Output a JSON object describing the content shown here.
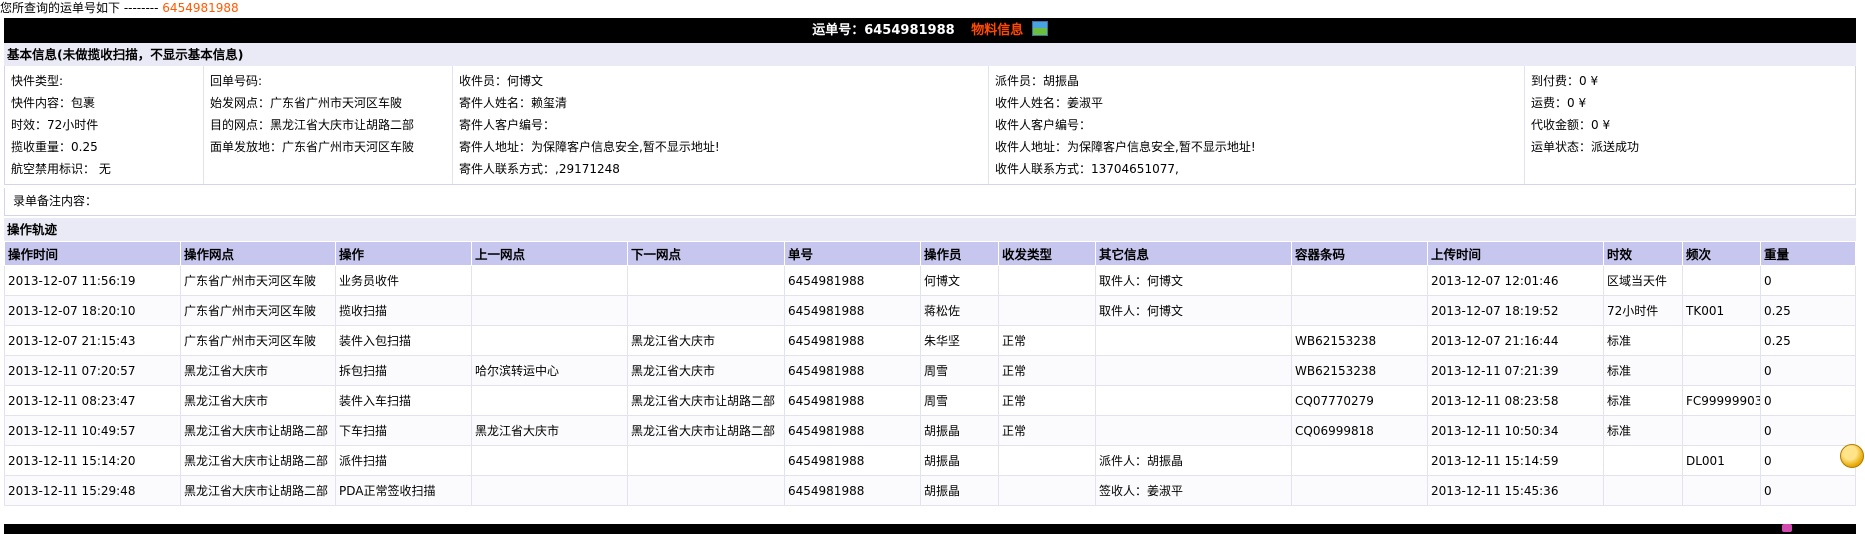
{
  "query": {
    "prefix": "您所查询的运单号如下 --------",
    "number": "6454981988"
  },
  "title": {
    "label": "运单号：6454981988",
    "material_link": "物料信息"
  },
  "basic": {
    "heading": "基本信息(未做揽收扫描，不显示基本信息)",
    "col1": [
      "快件类型:",
      "快件内容：包裹",
      "时效：72小时件",
      "揽收重量：0.25",
      "航空禁用标识： 无"
    ],
    "col2": [
      "回单号码:",
      "始发网点：广东省广州市天河区车陂",
      "目的网点：黑龙江省大庆市让胡路二部",
      "面单发放地：广东省广州市天河区车陂"
    ],
    "col3": [
      "收件员：何博文",
      "寄件人姓名：赖玺清",
      "寄件人客户编号：",
      "寄件人地址：为保障客户信息安全,暂不显示地址!",
      "寄件人联系方式：,29171248"
    ],
    "col4": [
      "派件员：胡振晶",
      "收件人姓名：姜淑平",
      "收件人客户编号：",
      "收件人地址：为保障客户信息安全,暂不显示地址!",
      "收件人联系方式：13704651077,"
    ],
    "col5": [
      "到付费：0 ¥",
      "运费：0 ¥",
      "代收金额：0 ¥",
      "运单状态：派送成功"
    ]
  },
  "remarks": {
    "label": "录单备注内容："
  },
  "track": {
    "heading": "操作轨迹",
    "columns": [
      "操作时间",
      "操作网点",
      "操作",
      "上一网点",
      "下一网点",
      "单号",
      "操作员",
      "收发类型",
      "其它信息",
      "容器条码",
      "上传时间",
      "时效",
      "频次",
      "重量"
    ],
    "rows": [
      [
        "2013-12-07 11:56:19",
        "广东省广州市天河区车陂",
        "业务员收件",
        "",
        "",
        "6454981988",
        "何博文",
        "",
        "取件人：何博文",
        "",
        "2013-12-07 12:01:46",
        "区域当天件",
        "",
        "0"
      ],
      [
        "2013-12-07 18:20:10",
        "广东省广州市天河区车陂",
        "揽收扫描",
        "",
        "",
        "6454981988",
        "蒋松佐",
        "",
        "取件人：何博文",
        "",
        "2013-12-07 18:19:52",
        "72小时件",
        "TK001",
        "0.25"
      ],
      [
        "2013-12-07 21:15:43",
        "广东省广州市天河区车陂",
        "装件入包扫描",
        "",
        "黑龙江省大庆市",
        "6454981988",
        "朱华坚",
        "正常",
        "",
        "WB62153238",
        "2013-12-07 21:16:44",
        "标准",
        "",
        "0.25"
      ],
      [
        "2013-12-11 07:20:57",
        "黑龙江省大庆市",
        "拆包扫描",
        "哈尔滨转运中心",
        "黑龙江省大庆市",
        "6454981988",
        "周雪",
        "正常",
        "",
        "WB62153238",
        "2013-12-11 07:21:39",
        "标准",
        "",
        "0"
      ],
      [
        "2013-12-11 08:23:47",
        "黑龙江省大庆市",
        "装件入车扫描",
        "",
        "黑龙江省大庆市让胡路二部",
        "6454981988",
        "周雪",
        "正常",
        "",
        "CQ07770279",
        "2013-12-11 08:23:58",
        "标准",
        "FC99999903",
        "0"
      ],
      [
        "2013-12-11 10:49:57",
        "黑龙江省大庆市让胡路二部",
        "下车扫描",
        "黑龙江省大庆市",
        "黑龙江省大庆市让胡路二部",
        "6454981988",
        "胡振晶",
        "正常",
        "",
        "CQ06999818",
        "2013-12-11 10:50:34",
        "标准",
        "",
        "0"
      ],
      [
        "2013-12-11 15:14:20",
        "黑龙江省大庆市让胡路二部",
        "派件扫描",
        "",
        "",
        "6454981988",
        "胡振晶",
        "",
        "派件人：胡振晶",
        "",
        "2013-12-11 15:14:59",
        "",
        "DL001",
        "0"
      ],
      [
        "2013-12-11 15:29:48",
        "黑龙江省大庆市让胡路二部",
        "PDA正常签收扫描",
        "",
        "",
        "6454981988",
        "胡振晶",
        "",
        "签收人：姜淑平",
        "",
        "2013-12-11 15:45:36",
        "",
        "",
        "0"
      ]
    ]
  }
}
